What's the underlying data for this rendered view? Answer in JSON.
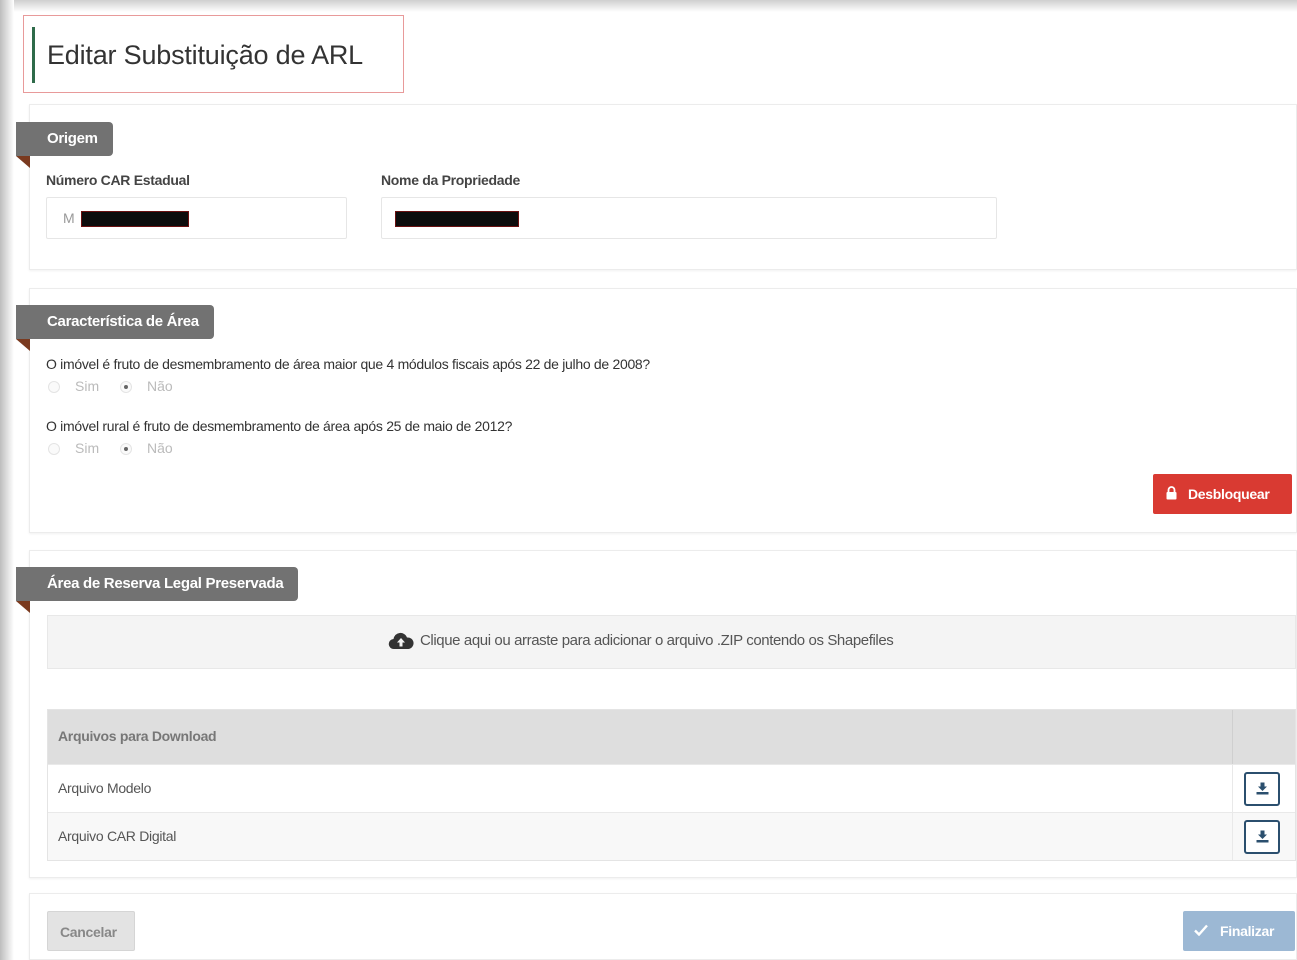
{
  "page": {
    "title": "Editar Substituição de ARL"
  },
  "origem": {
    "section_title": "Origem",
    "car_label": "Número CAR Estadual",
    "car_value": "M",
    "property_label": "Nome da Propriedade"
  },
  "caracteristica": {
    "section_title": "Característica de Área",
    "q1": {
      "text": "O imóvel é fruto de desmembramento de área maior que 4 módulos fiscais após 22 de julho de 2008?",
      "option_yes": "Sim",
      "option_no": "Não",
      "selected": "Não"
    },
    "q2": {
      "text": "O imóvel rural é fruto de desmembramento de área após 25 de maio de 2012?",
      "option_yes": "Sim",
      "option_no": "Não",
      "selected": "Não"
    },
    "unlock_button": "Desbloquear",
    "unlock_icon": "lock-icon"
  },
  "reserva": {
    "section_title": "Área de Reserva Legal Preservada",
    "dropzone_text": "Clique aqui ou arraste para adicionar o arquivo .ZIP contendo os Shapefiles",
    "dropzone_icon": "cloud-upload-icon",
    "table_header": "Arquivos para Download",
    "rows": [
      {
        "name": "Arquivo Modelo"
      },
      {
        "name": "Arquivo CAR Digital"
      }
    ],
    "download_icon": "download-icon"
  },
  "footer": {
    "cancel_button": "Cancelar",
    "finish_button": "Finalizar",
    "finish_icon": "check-icon"
  },
  "colors": {
    "unlock": "#d93a32",
    "finish": "#9cb8d4",
    "ribbon": "#727272",
    "ribbon_fold": "#7a3a1f",
    "header_accent": "#2f6b4a"
  }
}
